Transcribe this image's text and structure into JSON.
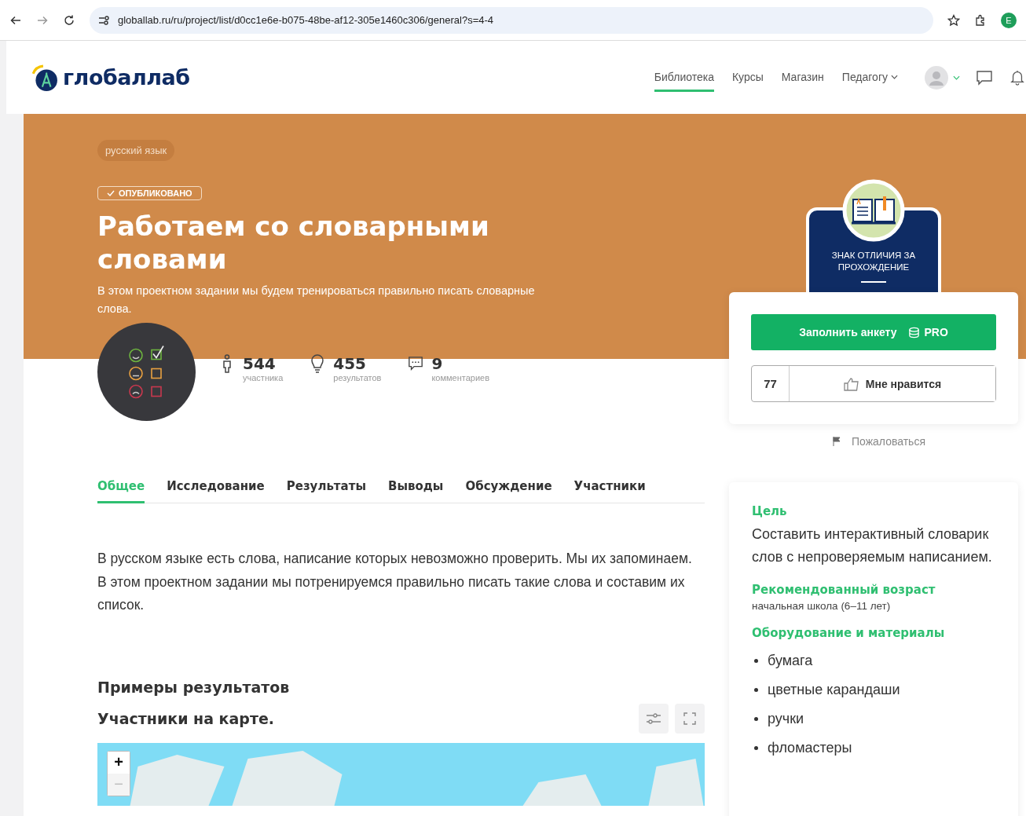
{
  "browser": {
    "url": "globallab.ru/ru/project/list/d0cc1e6e-b075-48be-af12-305e1460c306/general?s=4-4",
    "profile_letter": "E"
  },
  "header": {
    "logo": "глобаллаб",
    "nav": [
      {
        "label": "Библиотека",
        "selected": true,
        "has_menu": false
      },
      {
        "label": "Курсы",
        "selected": false,
        "has_menu": false
      },
      {
        "label": "Магазин",
        "selected": false,
        "has_menu": false
      },
      {
        "label": "Педагогу",
        "selected": false,
        "has_menu": true
      }
    ]
  },
  "hero": {
    "subject_tag": "русский язык",
    "status": "ОПУБЛИКОВАНО",
    "title": "Работаем со словарными словами",
    "description": "В этом проектном задании мы будем тренироваться правильно писать словарные слова."
  },
  "stats": [
    {
      "kind": "participants",
      "value": "544",
      "label": "участника"
    },
    {
      "kind": "results",
      "value": "455",
      "label": "результатов"
    },
    {
      "kind": "comments",
      "value": "9",
      "label": "комментариев"
    }
  ],
  "badge": {
    "text": "ЗНАК ОТЛИЧИЯ ЗА ПРОХОЖДЕНИЕ"
  },
  "actions": {
    "primary_button": "Заполнить анкету",
    "pro_label": "PRO",
    "likes_count": "77",
    "like_button": "Мне нравится",
    "report_link": "Пожаловаться"
  },
  "tabs": [
    {
      "label": "Общее",
      "selected": true
    },
    {
      "label": "Исследование",
      "selected": false
    },
    {
      "label": "Результаты",
      "selected": false
    },
    {
      "label": "Выводы",
      "selected": false
    },
    {
      "label": "Обсуждение",
      "selected": false
    },
    {
      "label": "Участники",
      "selected": false
    }
  ],
  "intro": "В русском языке есть слова, написание которых невозможно проверить. Мы их запоминаем. В этом проектном задании мы потренируемся правильно писать такие слова и составим их список.",
  "results_heading": "Примеры результатов",
  "map": {
    "title": "Участники на карте.",
    "zoom_in": {
      "label": "+",
      "disabled": false
    },
    "zoom_out": {
      "label": "−",
      "disabled": true
    }
  },
  "sidebar": [
    {
      "kind": "text",
      "heading": "Цель",
      "text": "Составить интерактивный словарик слов с непроверяемым написанием."
    },
    {
      "kind": "small",
      "heading": "Рекомендованный возраст",
      "text": "начальная школа (6–11 лет)"
    },
    {
      "kind": "list",
      "heading": "Оборудование и материалы",
      "items": [
        "бумага",
        "цветные карандаши",
        "ручки",
        "фломастеры"
      ]
    }
  ]
}
